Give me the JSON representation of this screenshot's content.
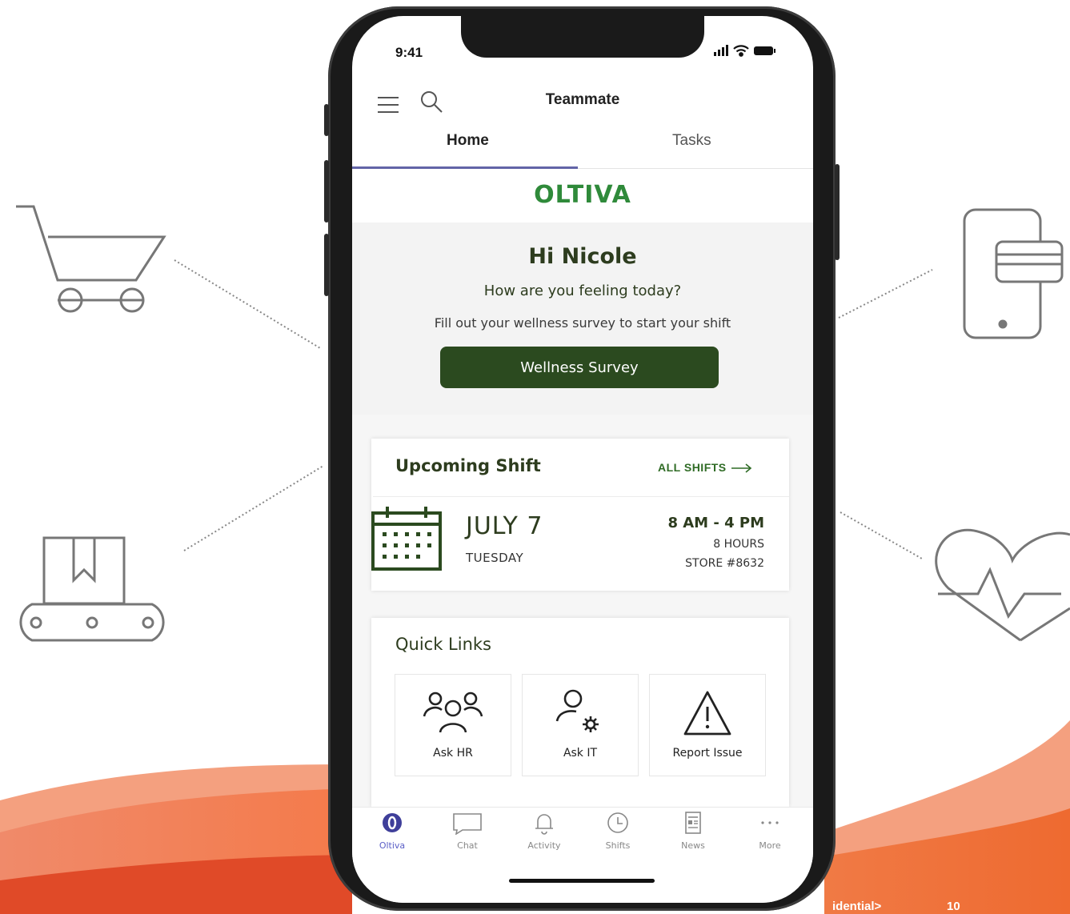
{
  "footer": {
    "confidential": "idential>",
    "page_number": "10"
  },
  "status_bar": {
    "time": "9:41"
  },
  "header": {
    "title": "Teammate"
  },
  "tabs": [
    {
      "label": "Home",
      "active": true
    },
    {
      "label": "Tasks",
      "active": false
    }
  ],
  "brand": {
    "logo_text": "OLTIVA",
    "color": "#2f8a3a"
  },
  "welcome": {
    "greeting": "Hi Nicole",
    "question": "How are you feeling today?",
    "instruction": "Fill out your wellness survey to start your shift",
    "button_label": "Wellness Survey",
    "button_color": "#2b4a1f"
  },
  "upcoming_shift": {
    "title": "Upcoming Shift",
    "all_shifts_label": "ALL SHIFTS",
    "date": "JULY 7",
    "weekday": "TUESDAY",
    "time": "8 AM - 4 PM",
    "hours": "8 HOURS",
    "store": "STORE #8632"
  },
  "quick_links": {
    "title": "Quick Links",
    "items": [
      {
        "label": "Ask HR",
        "icon": "people-icon"
      },
      {
        "label": "Ask IT",
        "icon": "person-gear-icon"
      },
      {
        "label": "Report Issue",
        "icon": "warning-icon"
      }
    ]
  },
  "bottom_nav": {
    "items": [
      {
        "label": "Oltiva",
        "icon": "oltiva-icon",
        "active": true
      },
      {
        "label": "Chat",
        "icon": "chat-icon",
        "active": false
      },
      {
        "label": "Activity",
        "icon": "bell-icon",
        "active": false
      },
      {
        "label": "Shifts",
        "icon": "clock-icon",
        "active": false
      },
      {
        "label": "News",
        "icon": "news-icon",
        "active": false
      },
      {
        "label": "More",
        "icon": "more-icon",
        "active": false
      }
    ]
  },
  "decorations": {
    "left": [
      "shopping-cart-icon",
      "conveyor-box-icon"
    ],
    "right": [
      "mobile-payment-icon",
      "heart-pulse-icon"
    ],
    "accent_color": "#e8552d"
  }
}
